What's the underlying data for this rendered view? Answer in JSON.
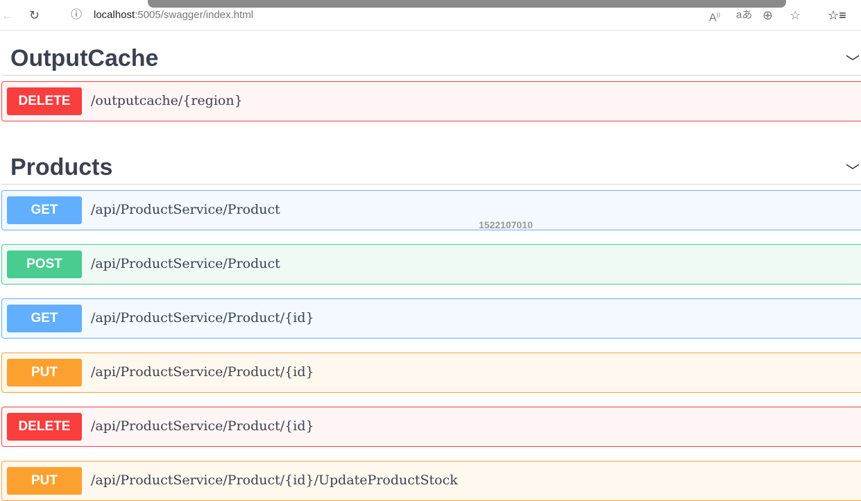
{
  "browser": {
    "url_host": "localhost",
    "url_rest": ":5005/swagger/index.html"
  },
  "sections": [
    {
      "title": "OutputCache"
    },
    {
      "title": "Products"
    }
  ],
  "operations": [
    {
      "method": "DELETE",
      "path": "/outputcache/{region}",
      "color": "#f93e3e",
      "bg": "#fff5f5"
    },
    {
      "method": "GET",
      "path": "/api/ProductService/Product",
      "color": "#61affe",
      "bg": "#f3f9ff"
    },
    {
      "method": "POST",
      "path": "/api/ProductService/Product",
      "color": "#49cc90",
      "bg": "#f0faf5"
    },
    {
      "method": "GET",
      "path": "/api/ProductService/Product/{id}",
      "color": "#61affe",
      "bg": "#f3f9ff"
    },
    {
      "method": "PUT",
      "path": "/api/ProductService/Product/{id}",
      "color": "#fca130",
      "bg": "#fff8ee"
    },
    {
      "method": "DELETE",
      "path": "/api/ProductService/Product/{id}",
      "color": "#f93e3e",
      "bg": "#fff5f5"
    },
    {
      "method": "PUT",
      "path": "/api/ProductService/Product/{id}/UpdateProductStock",
      "color": "#fca130",
      "bg": "#fff8ee"
    }
  ],
  "watermark": "1522107010"
}
